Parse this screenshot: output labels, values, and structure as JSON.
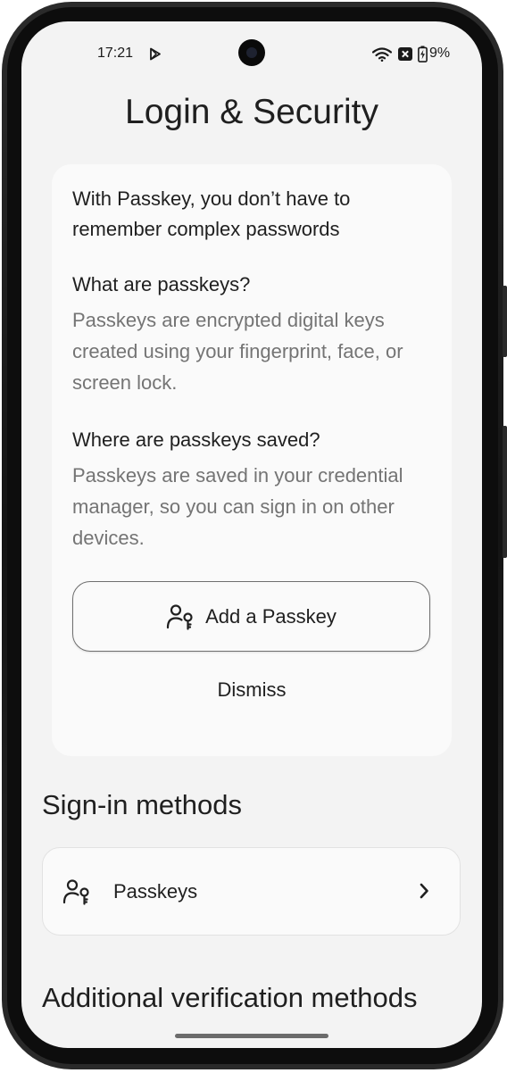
{
  "status_bar": {
    "time": "17:21",
    "battery": "9%"
  },
  "page": {
    "title": "Login & Security"
  },
  "passkey_card": {
    "intro": "With Passkey, you don’t have to remember complex passwords",
    "q1": "What are passkeys?",
    "a1": "Passkeys are encrypted digital keys created using your fingerprint, face, or screen lock.",
    "q2": "Where are passkeys saved?",
    "a2": "Passkeys are saved in your credential manager, so you can sign in on other devices.",
    "add_button": "Add a Passkey",
    "dismiss": "Dismiss"
  },
  "sign_in_methods": {
    "title": "Sign-in methods",
    "items": [
      {
        "label": "Passkeys"
      }
    ]
  },
  "additional": {
    "title": "Additional verification methods"
  },
  "icons": {
    "passkey": "person-key-icon",
    "chevron": "chevron-right-icon"
  },
  "colors": {
    "background": "#f3f3f3",
    "card": "#fafafa",
    "text": "#1f1f1f",
    "secondary_text": "#747474"
  }
}
